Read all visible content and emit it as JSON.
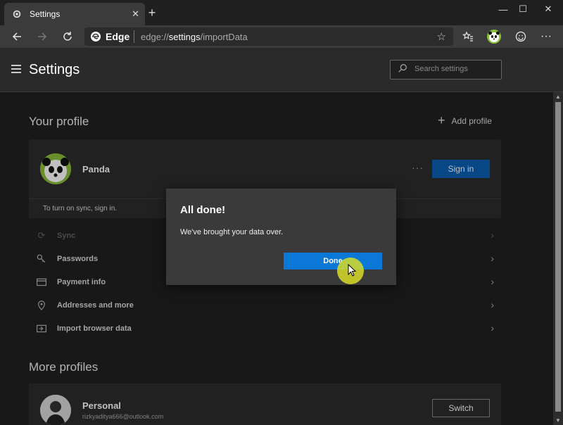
{
  "browser": {
    "tab_title": "Settings",
    "tab_close": "✕",
    "new_tab": "+",
    "window_controls": {
      "minimize": "—",
      "maximize": "☐",
      "close": "✕"
    },
    "address": {
      "site": "Edge",
      "url_prefix": "edge://",
      "url_main": "settings",
      "url_suffix": "/importData"
    },
    "toolbar_icons": [
      "back-icon",
      "forward-icon",
      "refresh-icon",
      "favorites-icon",
      "profile-icon",
      "emoji-icon",
      "more-icon"
    ],
    "more": "···"
  },
  "header": {
    "title": "Settings",
    "search_placeholder": "Search settings"
  },
  "your_profile": {
    "title": "Your profile",
    "add_profile": "Add profile",
    "name": "Panda",
    "more": "···",
    "sign_in": "Sign in",
    "sync_note": "To turn on sync, sign in."
  },
  "menu_items": [
    {
      "label": "Sync",
      "icon": "sync-icon",
      "disabled": true
    },
    {
      "label": "Passwords",
      "icon": "key-icon"
    },
    {
      "label": "Payment info",
      "icon": "card-icon"
    },
    {
      "label": "Addresses and more",
      "icon": "location-icon"
    },
    {
      "label": "Import browser data",
      "icon": "import-icon"
    }
  ],
  "more_profiles": {
    "title": "More profiles",
    "name": "Personal",
    "email": "rizkyaditya666@outlook.com",
    "switch": "Switch"
  },
  "dialog": {
    "title": "All done!",
    "message": "We've brought your data over.",
    "button": "Done"
  },
  "colors": {
    "accent": "#0b78d7",
    "sign_in": "#0a5fb3",
    "highlight": "#d8dc28"
  }
}
